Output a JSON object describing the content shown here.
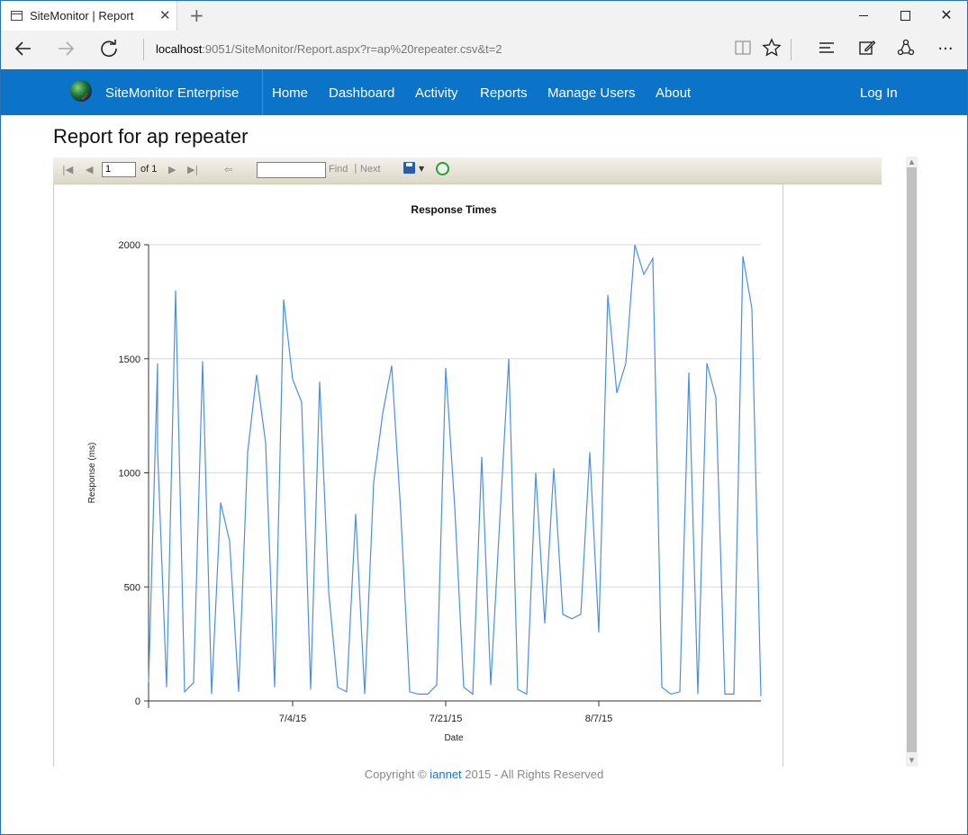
{
  "browser": {
    "tab_title": "SiteMonitor | Report",
    "tab_close": "✕",
    "new_tab": "+",
    "url_host": "localhost",
    "url_rest": ":9051/SiteMonitor/Report.aspx?r=ap%20repeater.csv&t=2",
    "icons": [
      "back-icon",
      "forward-icon",
      "refresh-icon",
      "reading-view-icon",
      "favorite-star-icon",
      "hub-icon",
      "web-note-icon",
      "share-icon",
      "more-icon"
    ]
  },
  "site": {
    "brand": "SiteMonitor Enterprise",
    "menu": [
      "Home",
      "Dashboard",
      "Activity",
      "Reports",
      "Manage Users",
      "About"
    ],
    "login": "Log In"
  },
  "page": {
    "title": "Report for ap repeater"
  },
  "report_toolbar": {
    "page_value": "1",
    "page_of": "of 1",
    "find_value": "",
    "find_label": "Find",
    "separator": "|",
    "next_label": "Next"
  },
  "footer": {
    "prefix": "Copyright © ",
    "link": "iannet",
    "suffix": " 2015 - All Rights Reserved"
  },
  "chart_data": {
    "type": "line",
    "title": "Response Times",
    "xlabel": "Date",
    "ylabel": "Response (ms)",
    "ylim": [
      0,
      2000
    ],
    "yticks": [
      0,
      500,
      1000,
      1500,
      2000
    ],
    "xlim": [
      "2015-06-18",
      "2015-08-25"
    ],
    "xticks": [
      {
        "date": "2015-07-04",
        "label": "7/4/15"
      },
      {
        "date": "2015-07-21",
        "label": "7/21/15"
      },
      {
        "date": "2015-08-07",
        "label": "8/7/15"
      }
    ],
    "grid": true,
    "color": "#4a90e2",
    "series": [
      {
        "x": [
          "2015-06-18",
          "2015-06-19",
          "2015-06-19",
          "2015-06-20",
          "2015-06-21",
          "2015-06-22",
          "2015-06-23",
          "2015-06-24",
          "2015-06-25",
          "2015-06-26",
          "2015-06-27",
          "2015-06-28",
          "2015-06-29",
          "2015-06-30",
          "2015-07-01",
          "2015-07-02",
          "2015-07-03",
          "2015-07-04",
          "2015-07-05",
          "2015-07-06",
          "2015-07-07",
          "2015-07-08",
          "2015-07-09",
          "2015-07-10",
          "2015-07-11",
          "2015-07-12",
          "2015-07-13",
          "2015-07-14",
          "2015-07-15",
          "2015-07-16",
          "2015-07-17",
          "2015-07-18",
          "2015-07-19",
          "2015-07-20",
          "2015-07-21",
          "2015-07-22",
          "2015-07-23",
          "2015-07-24",
          "2015-07-25",
          "2015-07-26",
          "2015-07-27",
          "2015-07-28",
          "2015-07-29",
          "2015-07-30",
          "2015-07-31",
          "2015-08-01",
          "2015-08-02",
          "2015-08-03",
          "2015-08-04",
          "2015-08-05",
          "2015-08-06",
          "2015-08-07",
          "2015-08-08",
          "2015-08-09",
          "2015-08-10",
          "2015-08-11",
          "2015-08-12",
          "2015-08-13",
          "2015-08-14",
          "2015-08-15",
          "2015-08-16",
          "2015-08-17",
          "2015-08-18",
          "2015-08-19",
          "2015-08-20",
          "2015-08-21",
          "2015-08-22",
          "2015-08-23",
          "2015-08-24",
          "2015-08-25"
        ],
        "y": [
          80,
          1480,
          1100,
          60,
          1800,
          40,
          80,
          1490,
          30,
          870,
          700,
          40,
          1090,
          1430,
          1130,
          60,
          1760,
          1410,
          1310,
          50,
          1400,
          480,
          60,
          40,
          820,
          30,
          960,
          1260,
          1470,
          830,
          40,
          30,
          30,
          70,
          1460,
          850,
          60,
          30,
          1070,
          70,
          790,
          1500,
          50,
          30,
          1000,
          340,
          1020,
          380,
          360,
          380,
          1090,
          300,
          1780,
          1350,
          1480,
          2000,
          1870,
          1940,
          60,
          30,
          40,
          1440,
          30,
          1480,
          1330,
          30,
          30,
          1950,
          1720,
          20
        ]
      }
    ]
  }
}
